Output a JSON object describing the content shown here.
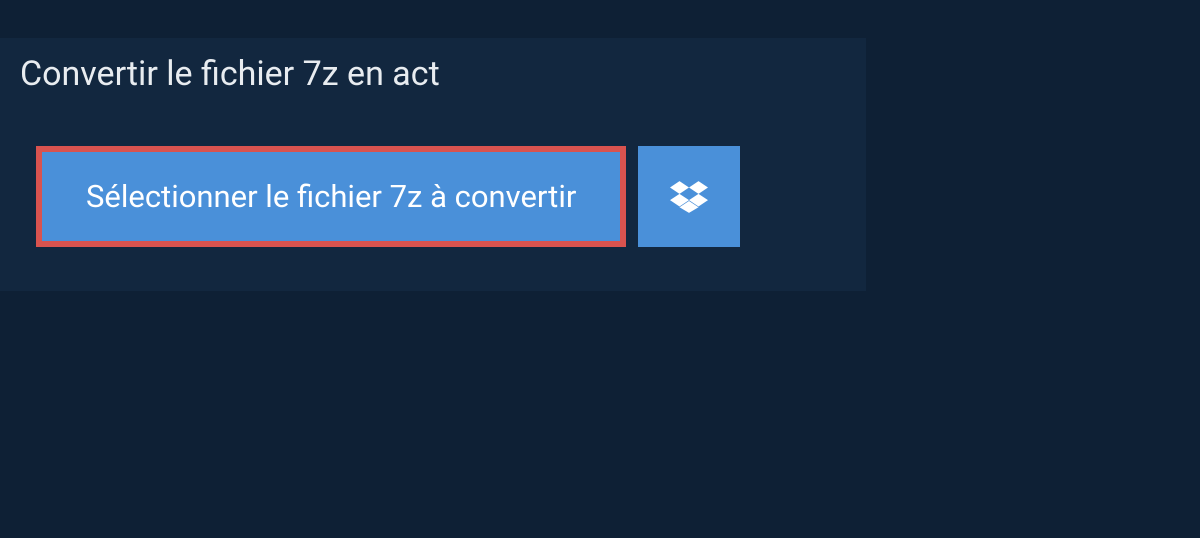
{
  "title": "Convertir le fichier 7z en act",
  "selectButton": {
    "label": "Sélectionner le fichier 7z à convertir"
  },
  "colors": {
    "pageBackground": "#0e2035",
    "panelBackground": "#12273f",
    "buttonBackground": "#4a90d9",
    "highlightBorder": "#d9534f",
    "textPrimary": "#e8ecf0",
    "textButton": "#ffffff"
  }
}
